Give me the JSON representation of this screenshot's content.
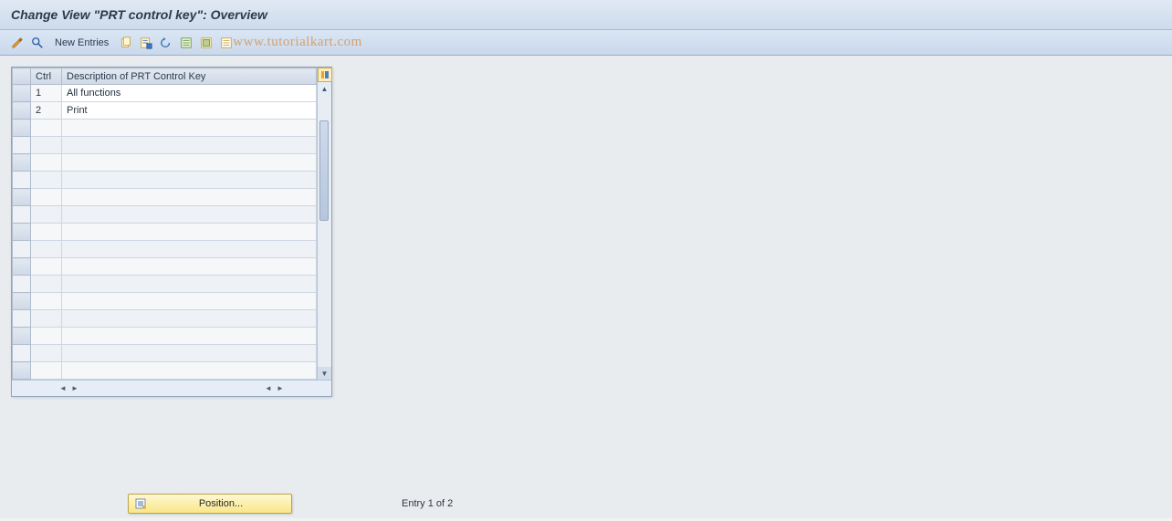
{
  "title": "Change View \"PRT control key\": Overview",
  "toolbar": {
    "new_entries_label": "New Entries"
  },
  "watermark": "www.tutorialkart.com",
  "table": {
    "columns": {
      "ctrl": "Ctrl",
      "desc": "Description of PRT Control Key"
    },
    "rows": [
      {
        "ctrl": "1",
        "desc": "All functions",
        "selected": true
      },
      {
        "ctrl": "2",
        "desc": "Print",
        "selected": false
      }
    ],
    "empty_rows": 15
  },
  "footer": {
    "position_label": "Position...",
    "entry_text": "Entry 1 of 2"
  },
  "icons": {
    "glasses": "glasses-icon",
    "find": "find-icon",
    "copy": "copy-icon",
    "save": "save-icon",
    "undo": "undo-icon",
    "select_all": "select-all-icon",
    "deselect_all": "deselect-all-icon",
    "variant": "variant-icon",
    "table_settings": "table-settings-icon",
    "position": "position-icon"
  }
}
